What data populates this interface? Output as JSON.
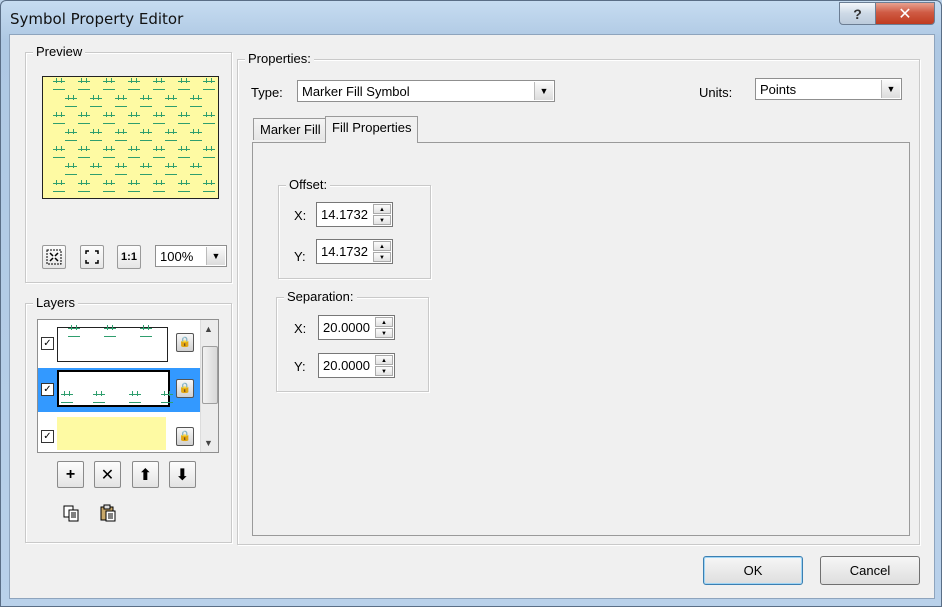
{
  "window": {
    "title": "Symbol Property Editor",
    "help_label": "?",
    "close_label": "✕"
  },
  "preview": {
    "group_label": "Preview",
    "fill_color": "#fefaa3",
    "marker_color": "#2f9e6e",
    "zoom": "100%",
    "buttons": {
      "zoom_in_icon": "fit-inward-icon",
      "zoom_out_icon": "fit-outward-icon",
      "actual_size_label": "1:1"
    }
  },
  "layers": {
    "group_label": "Layers",
    "items": [
      {
        "checked": true,
        "selected": false,
        "type": "marker-fill"
      },
      {
        "checked": true,
        "selected": true,
        "type": "marker-fill"
      },
      {
        "checked": true,
        "selected": false,
        "type": "simple-fill",
        "color": "#fefaa3"
      }
    ],
    "buttons": {
      "add": "+",
      "remove": "✕",
      "move_up": "⬆",
      "move_down": "⬇"
    }
  },
  "properties": {
    "group_label": "Properties:",
    "type_label": "Type:",
    "type_value": "Marker Fill Symbol",
    "units_label": "Units:",
    "units_value": "Points",
    "tabs": [
      {
        "label": "Marker Fill",
        "active": false
      },
      {
        "label": "Fill Properties",
        "active": true
      }
    ],
    "offset": {
      "label": "Offset:",
      "x_label": "X:",
      "x_value": "14.1732",
      "y_label": "Y:",
      "y_value": "14.1732"
    },
    "separation": {
      "label": "Separation:",
      "x_label": "X:",
      "x_value": "20.0000",
      "y_label": "Y:",
      "y_value": "20.0000"
    }
  },
  "footer": {
    "ok_label": "OK",
    "cancel_label": "Cancel"
  }
}
